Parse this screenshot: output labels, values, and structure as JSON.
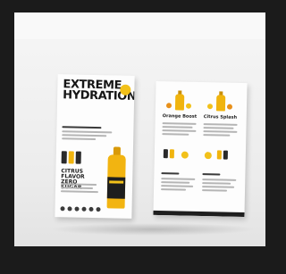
{
  "scene": {
    "background_color": "#1b1b1b",
    "wall_color": "#f1f1f1",
    "accent_yellow": "#f2b411",
    "dark": "#1e1e1e"
  },
  "flyer_front": {
    "headline": "EXTREME\nHYDRATION",
    "subheading": "CITRUS FLAVOR\nZERO SUGAR",
    "badge_icon": "circle-badge-icon",
    "product_icon": "bottle-icon"
  },
  "flyer_back": {
    "left_column_title": "Orange Boost",
    "right_column_title": "Citrus Splash",
    "product_icon": "bottle-icon"
  }
}
